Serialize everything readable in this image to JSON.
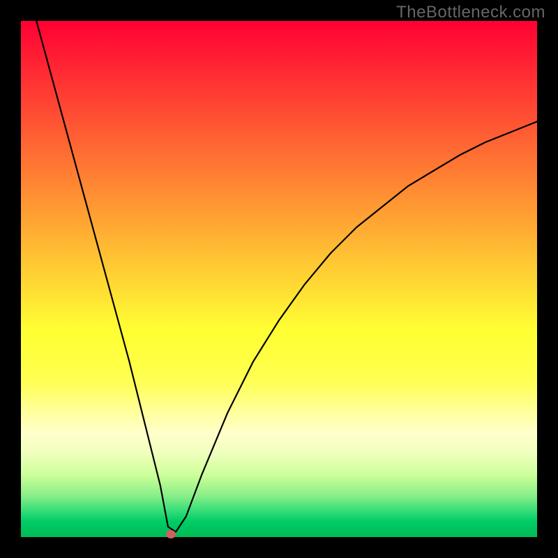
{
  "watermark": "TheBottleneck.com",
  "chart_data": {
    "type": "line",
    "title": "",
    "xlabel": "",
    "ylabel": "",
    "xlim": [
      0,
      100
    ],
    "ylim": [
      0,
      100
    ],
    "grid": false,
    "legend": false,
    "series": [
      {
        "name": "bottleneck-curve",
        "x": [
          3,
          6,
          9,
          12,
          15,
          18,
          21,
          24,
          27,
          28.5,
          30,
          32,
          35,
          40,
          45,
          50,
          55,
          60,
          65,
          70,
          75,
          80,
          85,
          90,
          95,
          100
        ],
        "y": [
          100,
          89,
          78,
          67,
          56,
          45,
          34,
          22,
          10,
          2,
          1,
          4,
          12,
          24,
          34,
          42,
          49,
          55,
          60,
          64,
          68,
          71,
          74,
          76.5,
          78.5,
          80.5
        ]
      }
    ],
    "marker": {
      "x": 29,
      "y": 0.5,
      "color": "#d06060"
    },
    "background_gradient": {
      "stops": [
        {
          "pos": 0,
          "color": "#ff0033"
        },
        {
          "pos": 50,
          "color": "#ffdd33"
        },
        {
          "pos": 80,
          "color": "#ffffcc"
        },
        {
          "pos": 100,
          "color": "#00bb55"
        }
      ]
    }
  }
}
